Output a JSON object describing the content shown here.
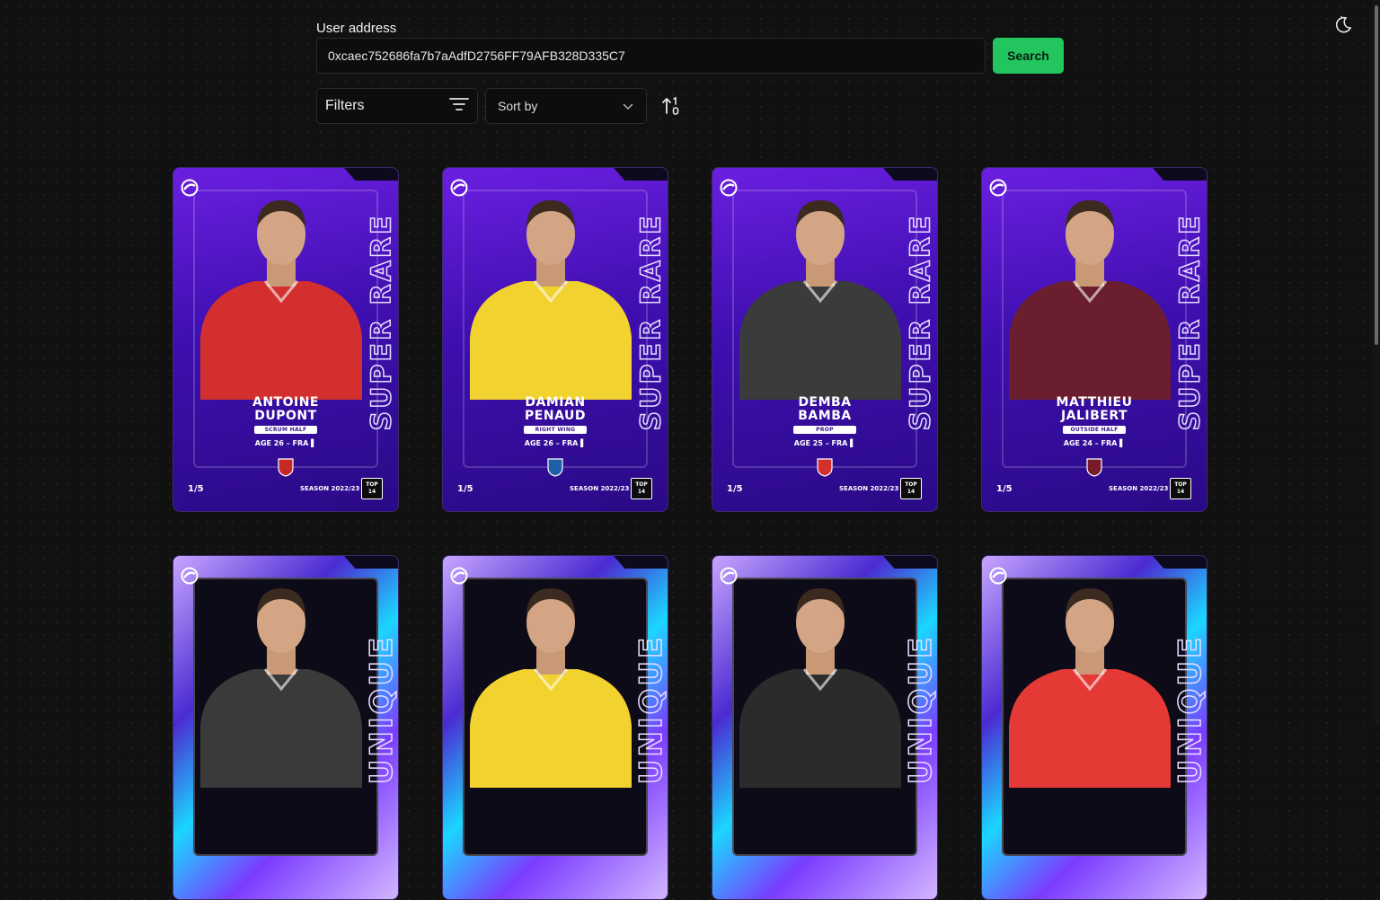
{
  "header": {
    "theme_toggle_icon": "moon-stars-icon"
  },
  "search": {
    "label": "User address",
    "address_value": "0xcaec752686fa7b7aAdfD2756FF79AFB328D335C7",
    "button_label": "Search"
  },
  "controls": {
    "filters_label": "Filters",
    "filters_icon": "filter-lines-icon",
    "sort_placeholder": "Sort by",
    "sort_icon": "chevron-down-icon",
    "sort_direction_icon": "sort-ascending-icon"
  },
  "colors": {
    "search_button": "#22c55e",
    "background": "#111111",
    "rare_card": "#4a14c4",
    "unique_card": "#7a3cff"
  },
  "cards": [
    {
      "rarity": "SUPER RARE",
      "first_name": "ANTOINE",
      "last_name": "DUPONT",
      "position": "SCRUM HALF",
      "age": "AGE 26",
      "nationality": "FRA",
      "serial": "1/5",
      "season": "SEASON 2022/23",
      "league": "TOP 14",
      "jersey": "#d32f2f",
      "club_badge": "#c62828"
    },
    {
      "rarity": "SUPER RARE",
      "first_name": "DAMIAN",
      "last_name": "PENAUD",
      "position": "RIGHT WING",
      "age": "AGE 26",
      "nationality": "FRA",
      "serial": "1/5",
      "season": "SEASON 2022/23",
      "league": "TOP 14",
      "jersey": "#f2d22e",
      "club_badge": "#1f5fa8"
    },
    {
      "rarity": "SUPER RARE",
      "first_name": "DEMBA",
      "last_name": "BAMBA",
      "position": "PROP",
      "age": "AGE 25",
      "nationality": "FRA",
      "serial": "1/5",
      "season": "SEASON 2022/23",
      "league": "TOP 14",
      "jersey": "#3b3b3b",
      "club_badge": "#d32f2f"
    },
    {
      "rarity": "SUPER RARE",
      "first_name": "MATTHIEU",
      "last_name": "JALIBERT",
      "position": "OUTSIDE HALF",
      "age": "AGE 24",
      "nationality": "FRA",
      "serial": "1/5",
      "season": "SEASON 2022/23",
      "league": "TOP 14",
      "jersey": "#6b1f2e",
      "club_badge": "#7a1b2b"
    },
    {
      "rarity": "UNIQUE",
      "jersey": "#3a3a3a"
    },
    {
      "rarity": "UNIQUE",
      "jersey": "#f2d22e"
    },
    {
      "rarity": "UNIQUE",
      "jersey": "#2b2b2b"
    },
    {
      "rarity": "UNIQUE",
      "jersey": "#e53935"
    }
  ]
}
